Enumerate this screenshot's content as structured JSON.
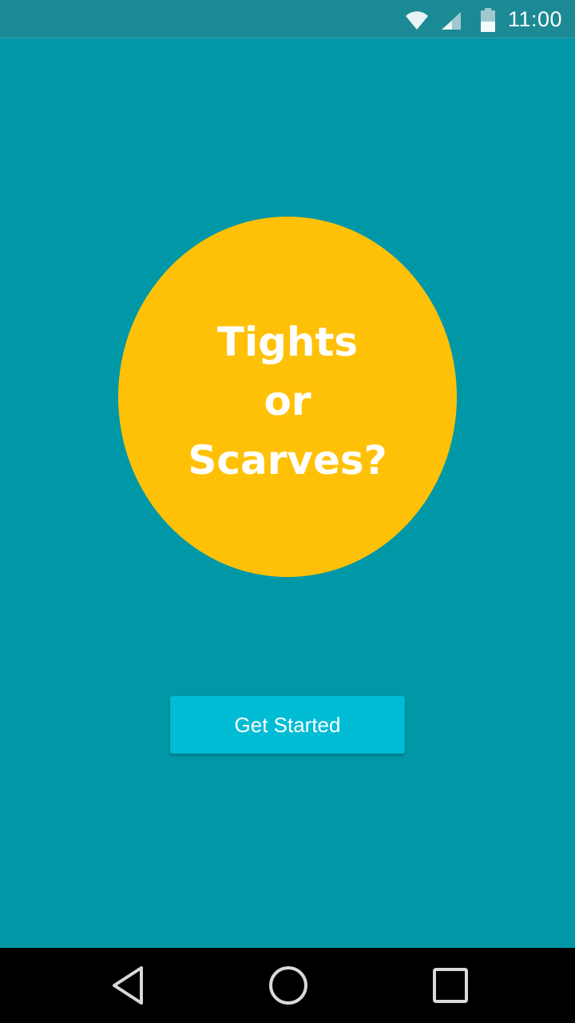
{
  "status_bar": {
    "time": "11:00",
    "icons": [
      "wifi-icon",
      "cell-signal-icon",
      "battery-icon"
    ]
  },
  "hero": {
    "lines": [
      "Tights",
      "or",
      "Scarves?"
    ]
  },
  "actions": {
    "get_started_label": "Get Started"
  },
  "navigation": {
    "buttons": [
      "back-icon",
      "home-icon",
      "recent-apps-icon"
    ]
  },
  "colors": {
    "background": "#0097A7",
    "status_bar": "#1C8A94",
    "circle": "#FFC107",
    "button": "#00BCD4",
    "text": "#FFFFFF",
    "nav_bar": "#000000"
  }
}
